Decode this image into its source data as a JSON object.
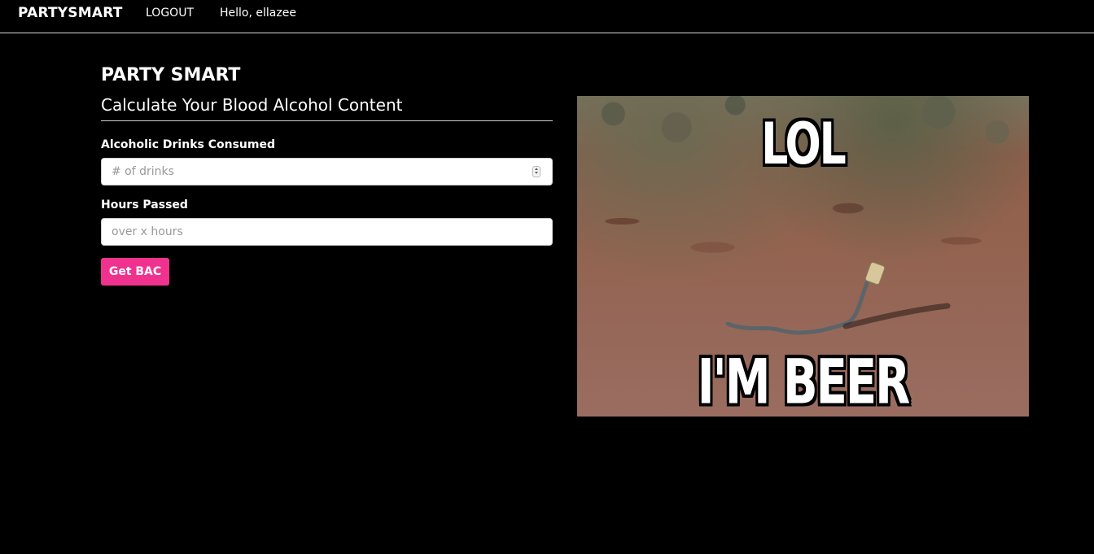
{
  "navbar": {
    "brand": "PARTYSMART",
    "logout_label": "LOGOUT",
    "greeting": "Hello, ellazee"
  },
  "main": {
    "title": "PARTY SMART",
    "subtitle": "Calculate Your Blood Alcohol Content",
    "drinks": {
      "label": "Alcoholic Drinks Consumed",
      "value": "",
      "placeholder": "# of drinks"
    },
    "hours": {
      "label": "Hours Passed",
      "value": "",
      "placeholder": "over x hours"
    },
    "submit_label": "Get BAC"
  },
  "meme": {
    "top_text": "LOL",
    "bottom_text": "I'M BEER"
  },
  "colors": {
    "background": "#000000",
    "accent": "#f0328f",
    "text": "#ffffff"
  }
}
